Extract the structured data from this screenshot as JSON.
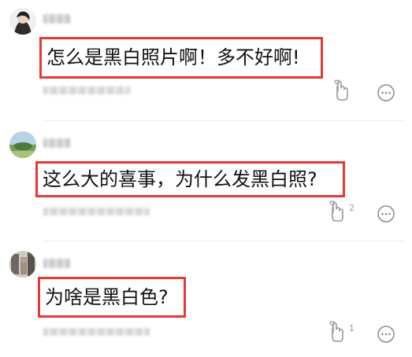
{
  "comments": [
    {
      "text": "怎么是黑白照片啊！多不好啊!",
      "like_count": ""
    },
    {
      "text": "这么大的喜事，为什么发黑白照?",
      "like_count": "2"
    },
    {
      "text": "为啥是黑白色?",
      "like_count": "1"
    }
  ],
  "colors": {
    "highlight_border": "#e53935",
    "text": "#111111",
    "muted": "#9a9a9a",
    "divider": "#ececec"
  }
}
